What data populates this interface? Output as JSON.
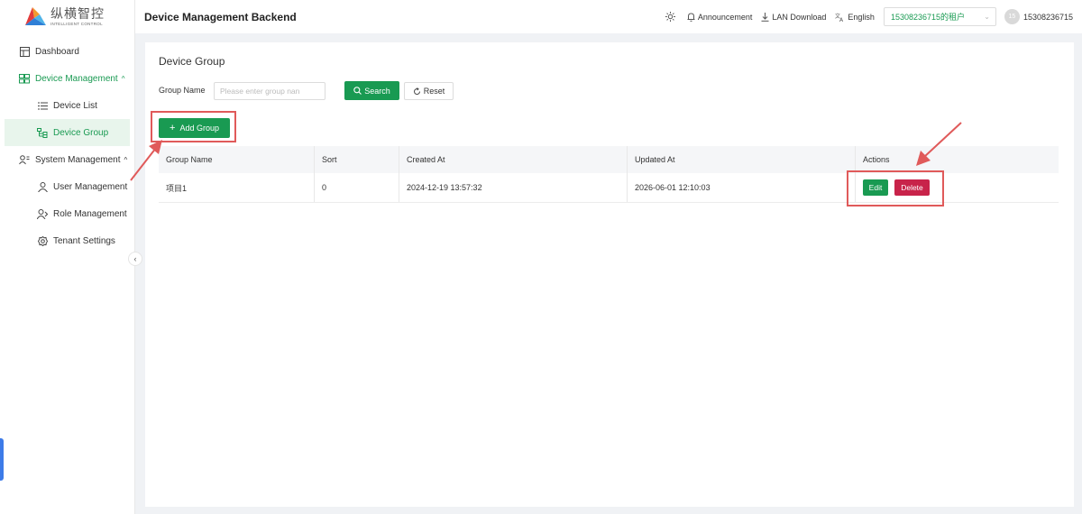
{
  "brand": {
    "name_cn": "纵横智控",
    "name_en": "INTELLIGENT CONTROL",
    "colors": {
      "primary": "#199a52",
      "danger": "#c8234a",
      "annotation": "#e05a5a"
    }
  },
  "sidebar": {
    "items": [
      {
        "label": "Dashboard",
        "icon": "dashboard-icon"
      },
      {
        "label": "Device Management",
        "icon": "device-management-icon",
        "expanded": true
      },
      {
        "label": "Device List",
        "icon": "list-icon"
      },
      {
        "label": "Device Group",
        "icon": "group-icon",
        "active": true
      },
      {
        "label": "System Management",
        "icon": "users-icon",
        "expanded": true
      },
      {
        "label": "User Management",
        "icon": "user-icon"
      },
      {
        "label": "Role Management",
        "icon": "role-icon"
      },
      {
        "label": "Tenant Settings",
        "icon": "gear-icon"
      }
    ],
    "collapse_glyph": "‹"
  },
  "header": {
    "title": "Device Management Backend",
    "announcement": "Announcement",
    "lan_download": "LAN Download",
    "language": "English",
    "tenant": "15308236715的租户",
    "avatar_initials": "15",
    "username": "15308236715"
  },
  "page": {
    "title": "Device Group",
    "filter": {
      "label": "Group Name",
      "placeholder": "Please enter group nan"
    },
    "buttons": {
      "search": "Search",
      "reset": "Reset",
      "add": "Add Group"
    },
    "table": {
      "columns": [
        "Group Name",
        "Sort",
        "Created At",
        "Updated At",
        "Actions"
      ],
      "rows": [
        {
          "group_name": "项目1",
          "sort": "0",
          "created_at": "2024-12-19 13:57:32",
          "updated_at": "2026-06-01 12:10:03",
          "edit": "Edit",
          "delete": "Delete"
        }
      ]
    }
  }
}
